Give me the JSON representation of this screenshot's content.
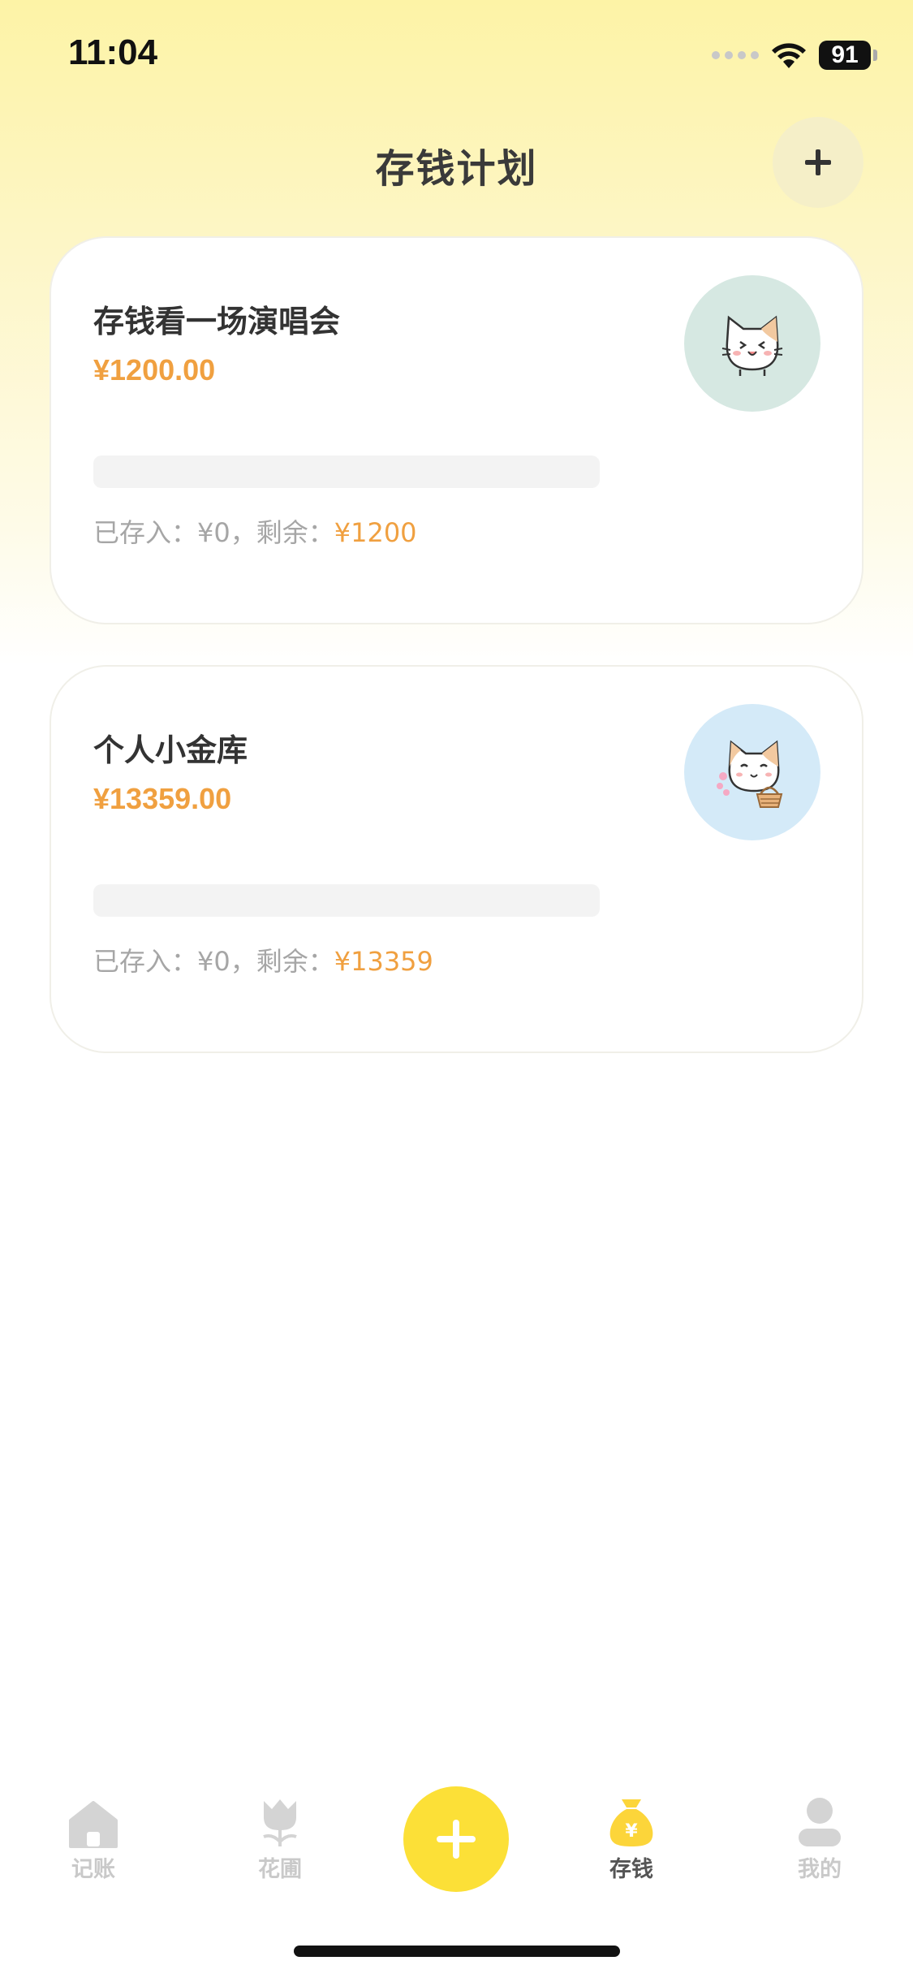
{
  "status_bar": {
    "time": "11:04",
    "battery": "91"
  },
  "header": {
    "title": "存钱计划"
  },
  "plans": [
    {
      "name": "存钱看一场演唱会",
      "amount": "¥1200.00",
      "saved_text": "已存入：¥0，剩余：",
      "remaining": "¥1200",
      "progress": 0,
      "avatar_bg": "#d6e8e2"
    },
    {
      "name": "个人小金库",
      "amount": "¥13359.00",
      "saved_text": "已存入：¥0，剩余：",
      "remaining": "¥13359",
      "progress": 0,
      "avatar_bg": "#d4eaf8"
    }
  ],
  "tab_bar": {
    "tabs": [
      {
        "label": "记账",
        "icon": "home-icon"
      },
      {
        "label": "花圃",
        "icon": "tulip-icon"
      },
      {
        "label": "存钱",
        "icon": "money-bag-icon",
        "active": true
      },
      {
        "label": "我的",
        "icon": "person-icon"
      }
    ]
  },
  "colors": {
    "accent": "#fce037",
    "amount": "#f0a040"
  }
}
